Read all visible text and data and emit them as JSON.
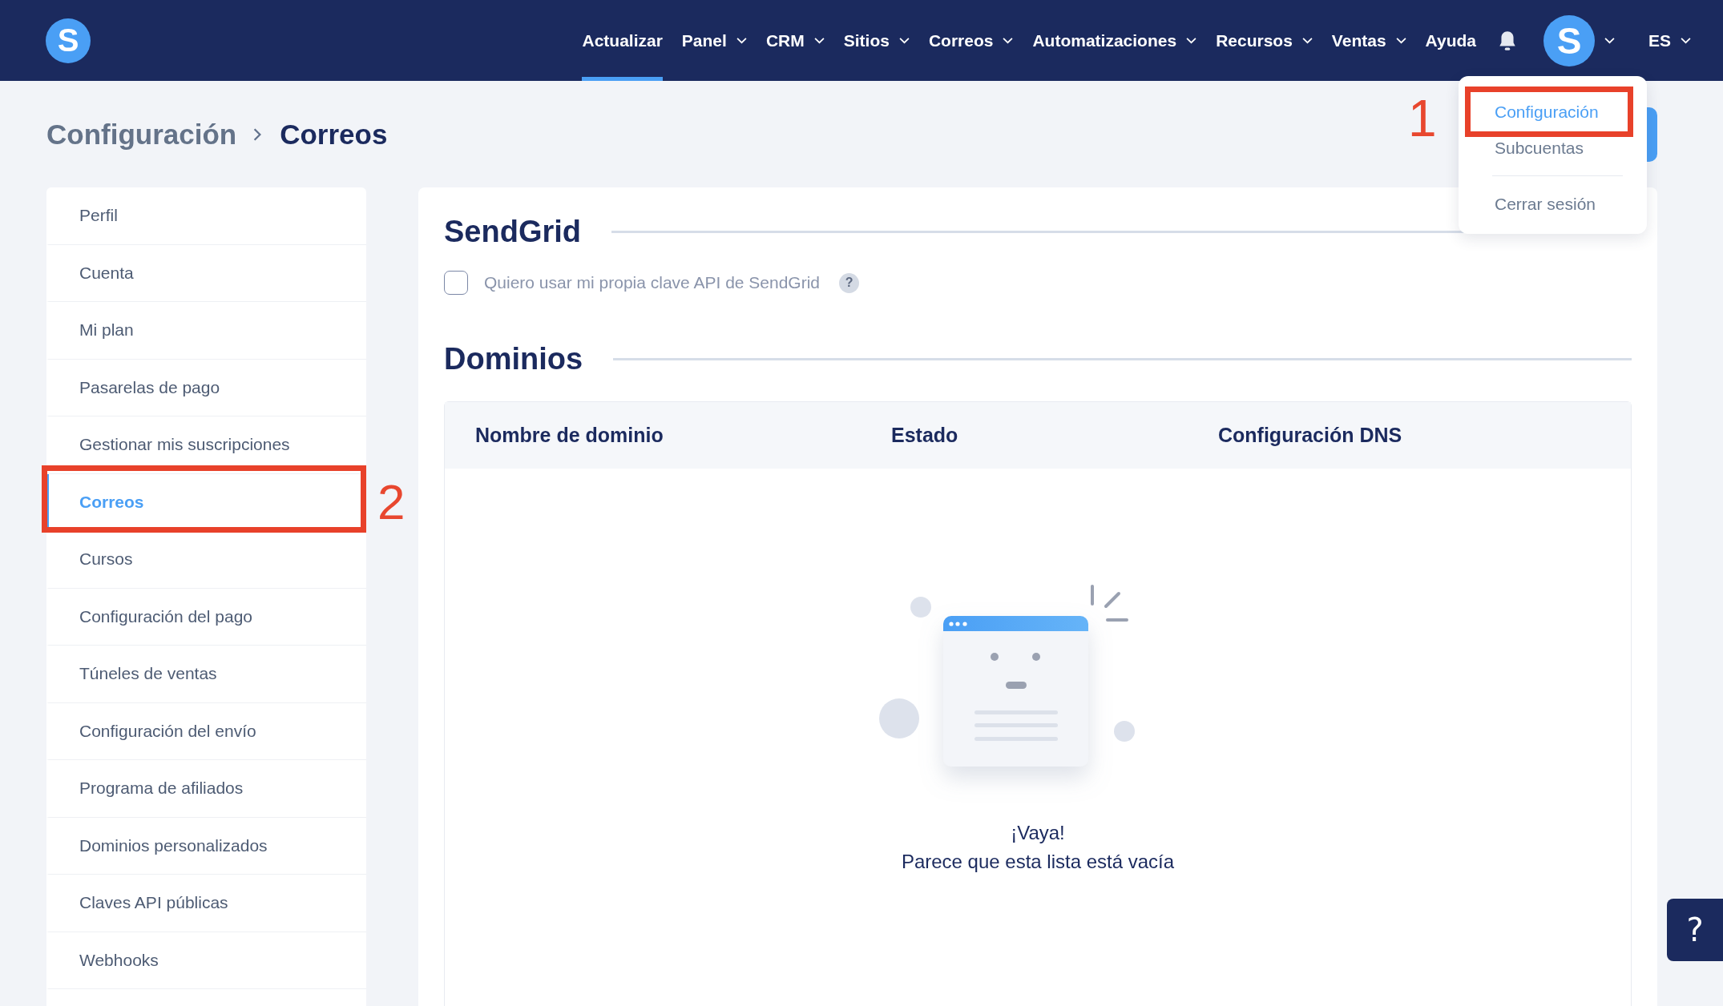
{
  "logo": "S",
  "nav": [
    {
      "label": "Actualizar",
      "dropdown": false,
      "selected": true
    },
    {
      "label": "Panel",
      "dropdown": true,
      "selected": false
    },
    {
      "label": "CRM",
      "dropdown": true,
      "selected": false
    },
    {
      "label": "Sitios",
      "dropdown": true,
      "selected": false
    },
    {
      "label": "Correos",
      "dropdown": true,
      "selected": false
    },
    {
      "label": "Automatizaciones",
      "dropdown": true,
      "selected": false
    },
    {
      "label": "Recursos",
      "dropdown": true,
      "selected": false
    },
    {
      "label": "Ventas",
      "dropdown": true,
      "selected": false
    },
    {
      "label": "Ayuda",
      "dropdown": false,
      "selected": false
    }
  ],
  "avatar": "S",
  "language": "ES",
  "account_menu": [
    {
      "label": "Configuración",
      "selected": true,
      "annotation": "1"
    },
    {
      "label": "Subcuentas",
      "selected": false
    },
    {
      "label": "Cerrar sesión",
      "selected": false
    }
  ],
  "breadcrumb": [
    "Configuración",
    "Correos"
  ],
  "sidebar": {
    "items": [
      {
        "label": "Perfil",
        "selected": false
      },
      {
        "label": "Cuenta",
        "selected": false
      },
      {
        "label": "Mi plan",
        "selected": false
      },
      {
        "label": "Pasarelas de pago",
        "selected": false
      },
      {
        "label": "Gestionar mis suscripciones",
        "selected": false
      },
      {
        "label": "Correos",
        "selected": true,
        "annotation": "2"
      },
      {
        "label": "Cursos",
        "selected": false
      },
      {
        "label": "Configuración del pago",
        "selected": false
      },
      {
        "label": "Túneles de ventas",
        "selected": false
      },
      {
        "label": "Configuración del envío",
        "selected": false
      },
      {
        "label": "Programa de afiliados",
        "selected": false
      },
      {
        "label": "Dominios personalizados",
        "selected": false
      },
      {
        "label": "Claves API públicas",
        "selected": false
      },
      {
        "label": "Webhooks",
        "selected": false
      }
    ]
  },
  "sendgrid": {
    "title": "SendGrid",
    "option": {
      "label": "Quiero usar mi propia clave API de SendGrid",
      "checked": false
    },
    "hint": "?"
  },
  "domains": {
    "title": "Dominios",
    "table": {
      "columns": [
        "Nombre de dominio",
        "Estado",
        "Configuración DNS"
      ]
    },
    "empty": {
      "title": "¡Vaya!",
      "message": "Parece que esta lista está vacía"
    }
  },
  "support_button": "?"
}
